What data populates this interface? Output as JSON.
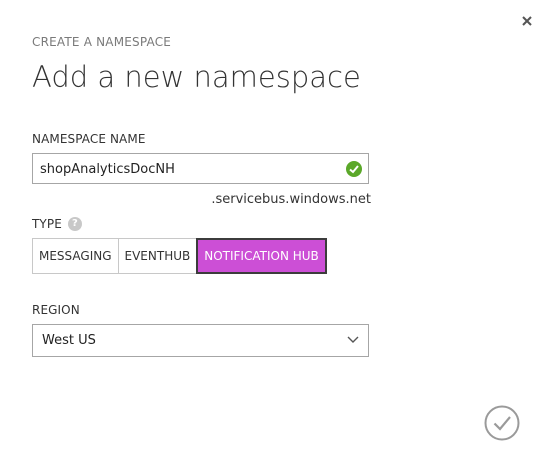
{
  "dialog": {
    "subtitle": "CREATE A NAMESPACE",
    "title": "Add a new namespace",
    "close_icon": "close-icon",
    "confirm_icon": "checkmark-circle-icon"
  },
  "namespace_name": {
    "label": "NAMESPACE NAME",
    "value": "shopAnalyticsDocNH",
    "valid_icon": "valid-check-icon",
    "suffix": ".servicebus.windows.net"
  },
  "type": {
    "label": "TYPE",
    "help_icon": "help-icon",
    "help_glyph": "?",
    "options": [
      {
        "label": "MESSAGING",
        "selected": false
      },
      {
        "label": "EVENTHUB",
        "selected": false
      },
      {
        "label": "NOTIFICATION HUB",
        "selected": true
      }
    ]
  },
  "region": {
    "label": "REGION",
    "value": "West US",
    "dropdown_icon": "chevron-down-icon"
  },
  "colors": {
    "selected_type_bg": "#cc4fd6",
    "valid_green": "#5ba829",
    "subtitle_gray": "#7a7a7a",
    "border_gray": "#a6a6a6"
  }
}
